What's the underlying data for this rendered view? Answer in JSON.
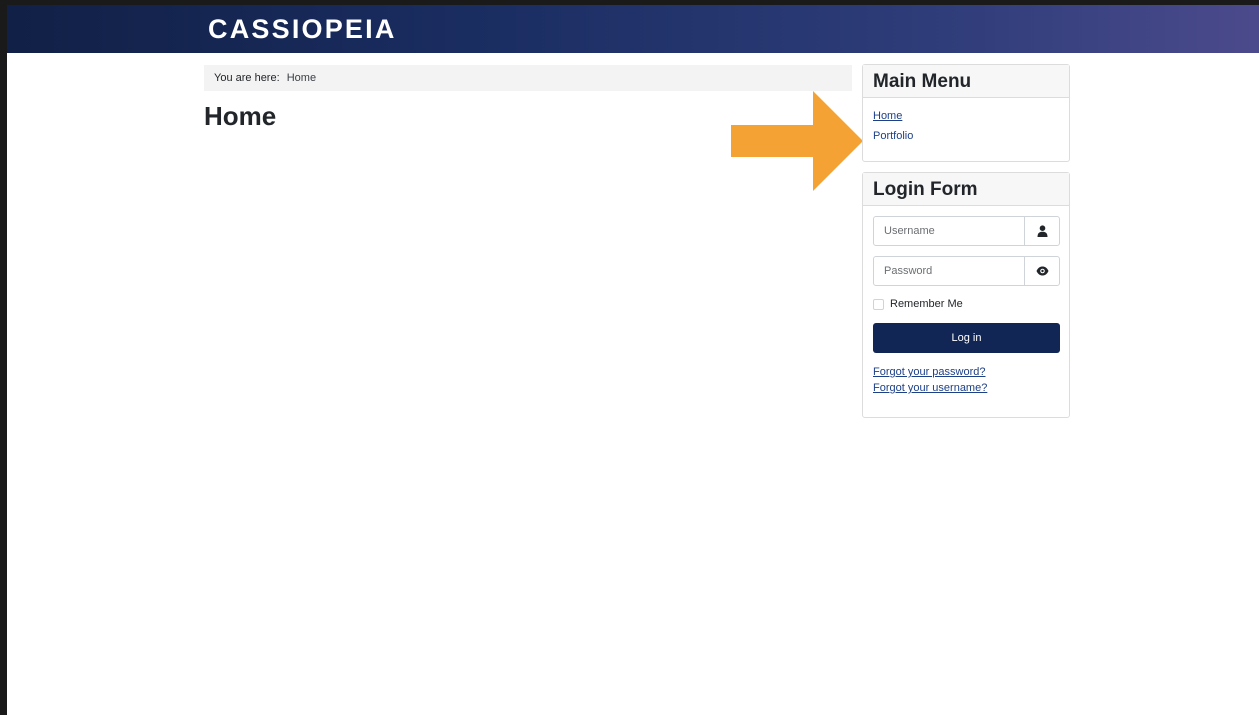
{
  "header": {
    "brand": "CASSIOPEIA"
  },
  "breadcrumb": {
    "prefix": "You are here:",
    "current": "Home"
  },
  "page": {
    "title": "Home"
  },
  "main_menu": {
    "title": "Main Menu",
    "items": [
      {
        "label": "Home"
      },
      {
        "label": "Portfolio"
      }
    ]
  },
  "login_form": {
    "title": "Login Form",
    "username_placeholder": "Username",
    "password_placeholder": "Password",
    "remember_label": "Remember Me",
    "login_label": "Log in",
    "forgot_password": "Forgot your password?",
    "forgot_username": "Forgot your username?"
  },
  "icons": {
    "username": "user-icon",
    "password": "eye-icon",
    "annotation": "arrow-right-icon"
  },
  "colors": {
    "header_gradient_start": "#112046",
    "header_gradient_end": "#4b4a8c",
    "button": "#112654",
    "link": "#1d4087",
    "arrow": "#f5a234"
  }
}
